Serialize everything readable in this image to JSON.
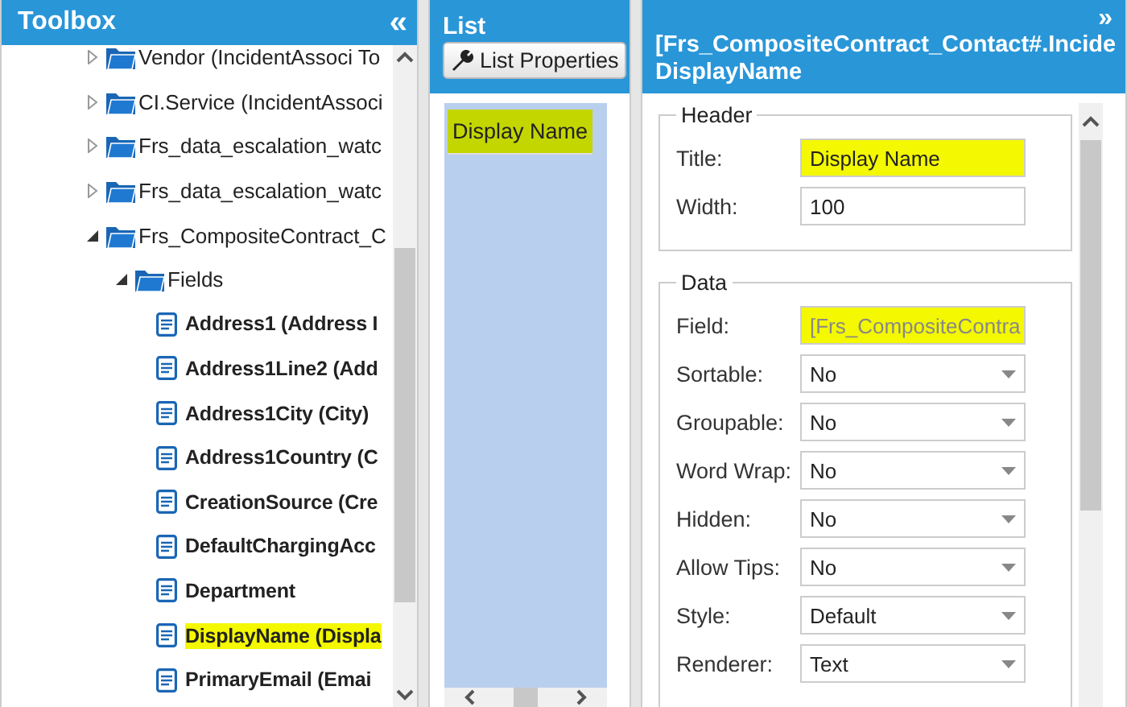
{
  "toolbox": {
    "title": "Toolbox",
    "collapse_icon": "«",
    "tree": [
      {
        "label": "Vendor (IncidentAssoci To",
        "expanded": false,
        "kind": "folder"
      },
      {
        "label": "CI.Service (IncidentAssoci",
        "expanded": false,
        "kind": "folder"
      },
      {
        "label": "Frs_data_escalation_watc",
        "expanded": false,
        "kind": "folder"
      },
      {
        "label": "Frs_data_escalation_watc",
        "expanded": false,
        "kind": "folder"
      },
      {
        "label": "Frs_CompositeContract_C",
        "expanded": true,
        "kind": "folder",
        "children": [
          {
            "label": "Fields",
            "expanded": true,
            "kind": "folder",
            "children": [
              {
                "label": "Address1 (Address I",
                "kind": "field",
                "highlighted": false
              },
              {
                "label": "Address1Line2 (Add",
                "kind": "field",
                "highlighted": false
              },
              {
                "label": "Address1City (City)",
                "kind": "field",
                "highlighted": false
              },
              {
                "label": "Address1Country (C",
                "kind": "field",
                "highlighted": false
              },
              {
                "label": "CreationSource (Cre",
                "kind": "field",
                "highlighted": false
              },
              {
                "label": "DefaultChargingAcc",
                "kind": "field",
                "highlighted": false
              },
              {
                "label": "Department",
                "kind": "field",
                "highlighted": false
              },
              {
                "label": "DisplayName (Displa",
                "kind": "field",
                "highlighted": true
              },
              {
                "label": "PrimaryEmail (Emai",
                "kind": "field",
                "highlighted": false
              }
            ]
          }
        ]
      }
    ]
  },
  "list": {
    "title": "List",
    "button": "List Properties",
    "columns": [
      {
        "label": "Display Name",
        "highlighted": true
      }
    ]
  },
  "properties": {
    "expand_icon": "»",
    "title": "[Frs_CompositeContract_Contact#.Incide",
    "subtitle": "DisplayName",
    "groups": [
      {
        "legend": "Header",
        "rows": [
          {
            "label": "Title:",
            "kind": "text",
            "value": "Display Name",
            "highlighted": true,
            "disabled": false
          },
          {
            "label": "Width:",
            "kind": "text",
            "value": "100",
            "highlighted": false,
            "disabled": false
          }
        ]
      },
      {
        "legend": "Data",
        "rows": [
          {
            "label": "Field:",
            "kind": "text",
            "value": "[Frs_CompositeContra",
            "highlighted": true,
            "disabled": true
          },
          {
            "label": "Sortable:",
            "kind": "select",
            "value": "No"
          },
          {
            "label": "Groupable:",
            "kind": "select",
            "value": "No"
          },
          {
            "label": "Word Wrap:",
            "kind": "select",
            "value": "No"
          },
          {
            "label": "Hidden:",
            "kind": "select",
            "value": "No"
          },
          {
            "label": "Allow Tips:",
            "kind": "select",
            "value": "No"
          },
          {
            "label": "Style:",
            "kind": "select",
            "value": "Default"
          },
          {
            "label": "Renderer:",
            "kind": "select",
            "value": "Text"
          }
        ]
      }
    ]
  }
}
